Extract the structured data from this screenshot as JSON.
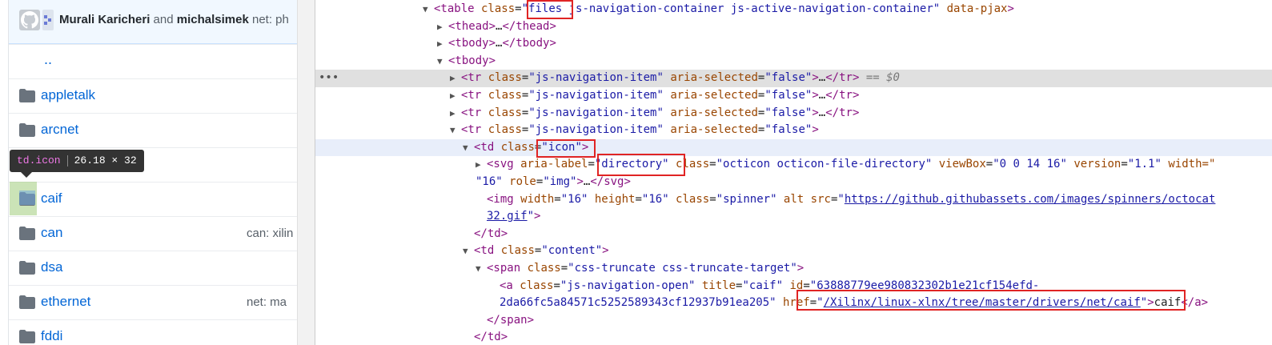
{
  "commit": {
    "author1": "Murali Karicheri",
    "and_text": " and ",
    "author2": "michalsimek",
    "message": " net: ph"
  },
  "files": {
    "up_dir": "..",
    "rows": [
      {
        "name": "appletalk",
        "msg": ""
      },
      {
        "name": "arcnet",
        "msg": ""
      },
      {
        "name": "caif",
        "msg": ""
      },
      {
        "name": "can",
        "msg": "can: xilin"
      },
      {
        "name": "dsa",
        "msg": ""
      },
      {
        "name": "ethernet",
        "msg": "net: ma"
      },
      {
        "name": "fddi",
        "msg": ""
      }
    ]
  },
  "tooltip": {
    "tag": "td.icon",
    "size": "26.18 × 32"
  },
  "devtools": {
    "eq_dollar": " == $0",
    "dots": "•••",
    "l0_attr_rest": " js-navigation-container js-active-navigation-container\"",
    "l0_attr2": " data-pjax",
    "class_files": "files",
    "nav_item_val": "\"js-navigation-item\"",
    "false_val": "\"false\"",
    "icon_val": "\"icon\"",
    "directory_val": "\"directory\"",
    "svg_class_val": "\"octicon octicon-file-directory\"",
    "svg_viewbox_val": "\"0 0 14 16\"",
    "svg_version_val": "\"1.1\"",
    "svg_width_attr": " width=\"",
    "svg_line2_val": "\"16\"",
    "svg_role_val": "\"img\"",
    "img_width_val": "\"16\"",
    "img_height_val": "\"16\"",
    "img_class_val": "\"spinner\"",
    "img_src_url": "https://github.githubassets.com/images/spinners/octocat",
    "img_src_url2": "32.gif",
    "content_val": "\"content\"",
    "span_class_val": "\"css-truncate css-truncate-target\"",
    "a_class_val": "\"js-navigation-open\"",
    "a_title_val": "\"caif\"",
    "a_id_val": "\"63888779ee980832302b1e21cf154efd-",
    "a_id_val2": "2da66fc5a84571c5252589343cf12937b91ea205\"",
    "href_url": "/Xilinx/linux-xlnx/tree/master/drivers/net/caif",
    "link_text": "caif"
  }
}
